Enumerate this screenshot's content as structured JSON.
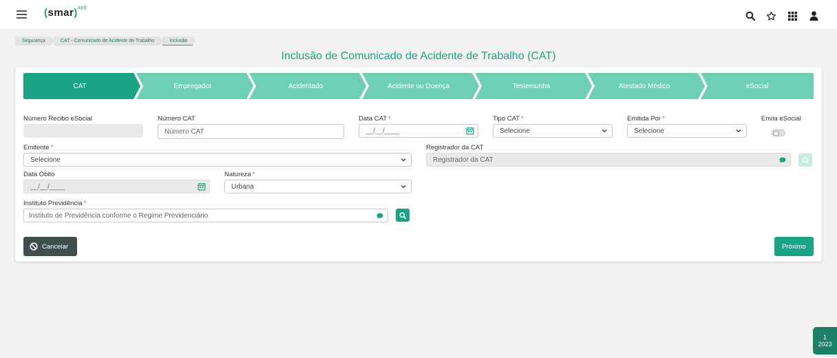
{
  "app": {
    "logo_text": "smar",
    "logo_super": "apd"
  },
  "topbar_icons": [
    "search-icon",
    "star-icon",
    "apps-grid-icon",
    "user-icon"
  ],
  "breadcrumb": [
    "Segurança",
    "CAT - Comunicado de Acidente de Trabalho",
    "Inclusão"
  ],
  "page_title": "Inclusão de Comunicado de Acidente de Trabalho (CAT)",
  "steps": [
    "CAT",
    "Empregador",
    "Acidentado",
    "Acidente ou Doença",
    "Testemunha",
    "Atestado Médico",
    "eSocial"
  ],
  "active_step": "CAT",
  "form": {
    "numero_recibo": {
      "label": "Número Recibo eSocial",
      "value": ""
    },
    "numero_cat": {
      "label": "Número CAT",
      "placeholder": "Número CAT"
    },
    "data_cat": {
      "label": "Data CAT",
      "required": "*",
      "placeholder": "__/__/____"
    },
    "tipo_cat": {
      "label": "Tipo CAT",
      "required": "*",
      "value": "Selecione"
    },
    "emitida_por": {
      "label": "Emitida Por",
      "required": "*",
      "value": "Selecione"
    },
    "envia_esocial": {
      "label": "Envia eSocial",
      "checked": false
    },
    "emitente": {
      "label": "Emitente",
      "required": "*",
      "value": "Selecione"
    },
    "registrador": {
      "label": "Registrador da CAT",
      "placeholder": "Registrador da CAT"
    },
    "data_obito": {
      "label": "Data Óbito",
      "placeholder": "__/__/____"
    },
    "natureza": {
      "label": "Natureza",
      "required": "*",
      "value": "Urbana"
    },
    "instituto": {
      "label": "Instituto Previdência",
      "required": "*",
      "placeholder": "Instituto de Previdência conforme o Regime Previdenciário"
    }
  },
  "buttons": {
    "cancel": "Cancelar",
    "next": "Próximo"
  },
  "year_badge": {
    "line1": "1",
    "line2": "2023"
  },
  "colors": {
    "accent": "#1aa384",
    "step_inactive": "#6ecfb5",
    "cancel_bg": "#3f4f4d",
    "required": "#d9534f"
  }
}
